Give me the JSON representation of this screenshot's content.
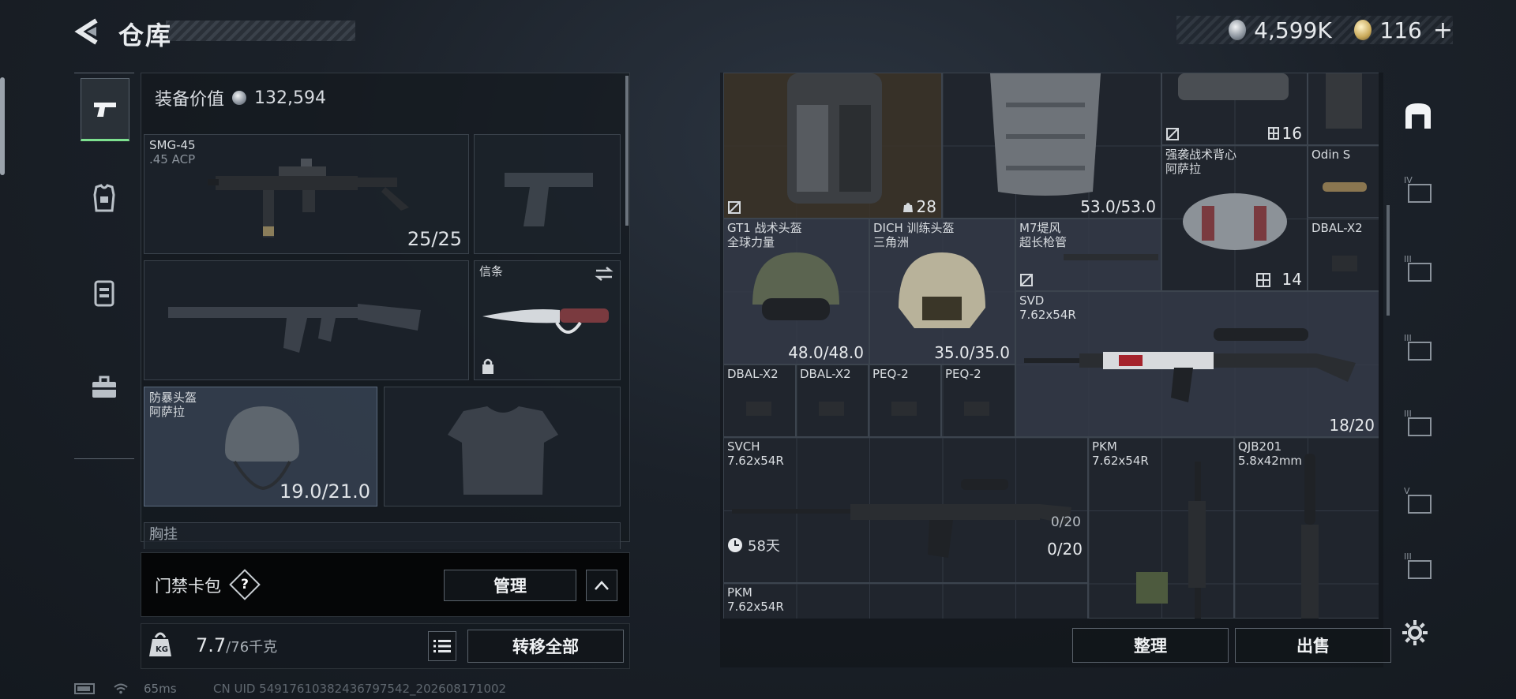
{
  "header": {
    "title": "仓库"
  },
  "currency": {
    "silver_amount": "4,599K",
    "gold_amount": "116",
    "plus_label": "+"
  },
  "left_panel": {
    "equip_value_label": "装备价值",
    "equip_value": "132,594",
    "primary_weapon": {
      "name": "SMG-45",
      "ammo": ".45 ACP",
      "count": "25/25"
    },
    "melee": {
      "name": "信条"
    },
    "helmet": {
      "name": "防暴头盔",
      "sub": "阿萨拉",
      "durability": "19.0/21.0"
    },
    "chest_rig_label": "胸挂"
  },
  "keycard": {
    "label": "门禁卡包",
    "help": "?",
    "manage_label": "管理",
    "collapse": "^"
  },
  "weight": {
    "current": "7.7",
    "max": "/76千克",
    "transfer_all_label": "转移全部"
  },
  "stash_items": [
    {
      "name": "",
      "sub": "",
      "value": "28"
    },
    {
      "name": "",
      "sub": "",
      "value": "53.0/53.0"
    },
    {
      "name": "",
      "sub": "",
      "value": "16"
    },
    {
      "name": "强袭战术背心",
      "sub": "阿萨拉",
      "value": ""
    },
    {
      "name": "Odin S",
      "sub": "",
      "value": ""
    },
    {
      "name": "GT1 战术头盔",
      "sub": "全球力量",
      "value": "48.0/48.0"
    },
    {
      "name": "DICH 训练头盔",
      "sub": "三角洲",
      "value": "35.0/35.0"
    },
    {
      "name": "M7堤风",
      "sub": "超长枪管",
      "value": ""
    },
    {
      "name": "",
      "sub": "",
      "value": "14"
    },
    {
      "name": "DBAL-X2",
      "sub": "",
      "value": ""
    },
    {
      "name": "SVD",
      "sub": "7.62x54R",
      "value": "18/20"
    },
    {
      "name": "DBAL-X2",
      "sub": "",
      "value": ""
    },
    {
      "name": "DBAL-X2",
      "sub": "",
      "value": ""
    },
    {
      "name": "PEQ-2",
      "sub": "",
      "value": ""
    },
    {
      "name": "PEQ-2",
      "sub": "",
      "value": ""
    },
    {
      "name": "SVCH",
      "sub": "7.62x54R",
      "value": "0/20",
      "mag": "0/20",
      "timer": "58天"
    },
    {
      "name": "PKM",
      "sub": "7.62x54R",
      "value": ""
    },
    {
      "name": "QJB201",
      "sub": "5.8x42mm",
      "value": ""
    },
    {
      "name": "PKM",
      "sub": "7.62x54R",
      "value": ""
    }
  ],
  "right_tabs": [
    "IV",
    "III",
    "III",
    "III",
    "V",
    "III"
  ],
  "actions": {
    "sort_label": "整理",
    "sell_label": "出售"
  },
  "status": {
    "ping": "65ms",
    "uid": "CN UID 54917610382436797542_202608171002"
  },
  "colors": {
    "accent_green": "#7de08f",
    "panel_bg": "#20252d"
  }
}
